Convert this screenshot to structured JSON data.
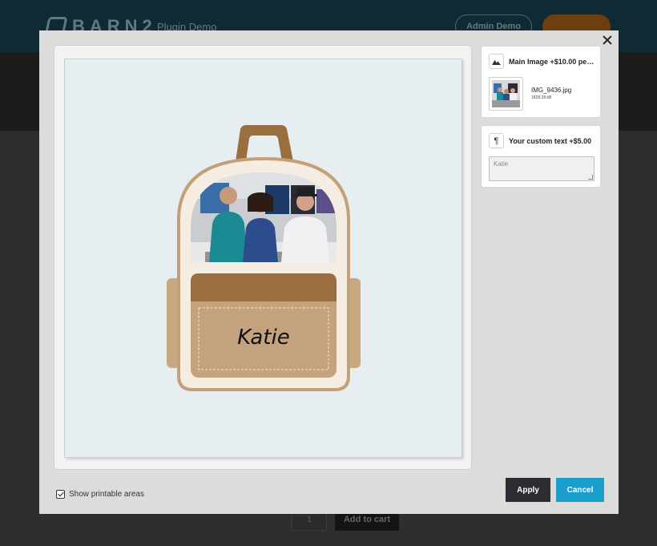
{
  "background": {
    "logo_text": "BARN2",
    "site_name": "Plugin Demo",
    "admin_label": "Admin Demo",
    "cta_label": "",
    "quantity": "1",
    "add_to_cart": "Add to cart"
  },
  "modal": {
    "close_icon": "close-icon",
    "preview": {
      "custom_text": "Katie",
      "colors": {
        "canvas_bg": "#e7eef2",
        "bag_outline": "#c4a07a",
        "bag_body": "#f5ede2",
        "strap": "#9a6f3f",
        "pocket_top": "#9a6e3e",
        "pocket": "#c4a27e",
        "side_pocket": "#c7a881"
      }
    },
    "image_field": {
      "icon": "image-icon",
      "title": "Main Image +$10.00 per ...",
      "file_name": "IMG_9436.jpg",
      "file_size": "1828.18 kB"
    },
    "text_field": {
      "icon": "paragraph-icon",
      "title": "Your custom text +$5.00",
      "value": "Katie"
    },
    "footer": {
      "show_printable_label": "Show printable areas",
      "show_printable_checked": true,
      "apply_label": "Apply",
      "cancel_label": "Cancel"
    }
  }
}
